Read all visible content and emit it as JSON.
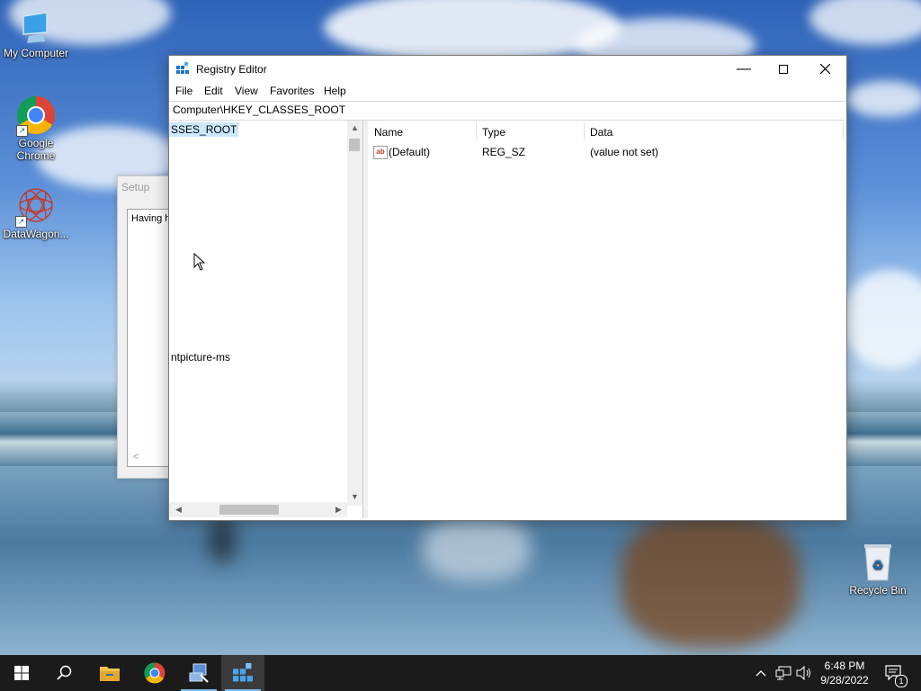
{
  "desktop": {
    "icons": [
      {
        "label": "My Computer",
        "icon": "monitor-icon"
      },
      {
        "label": "Google\nChrome",
        "icon": "chrome-icon"
      },
      {
        "label": "DataWagon...",
        "icon": "datawagon-icon"
      },
      {
        "label": "Recycle Bin",
        "icon": "recycle-bin-icon"
      }
    ]
  },
  "setup_window": {
    "title": "Setup",
    "text": "Having h"
  },
  "regedit": {
    "title": "Registry Editor",
    "menu": [
      "File",
      "Edit",
      "View",
      "Favorites",
      "Help"
    ],
    "address": "Computer\\HKEY_CLASSES_ROOT",
    "tree": {
      "selected": "SSES_ROOT",
      "item2": "ntpicture-ms"
    },
    "columns": [
      "Name",
      "Type",
      "Data"
    ],
    "rows": [
      {
        "name": "(Default)",
        "type": "REG_SZ",
        "data": "(value not set)"
      }
    ]
  },
  "taskbar": {
    "clock_time": "6:48 PM",
    "clock_date": "9/28/2022",
    "notification_count": "1"
  }
}
